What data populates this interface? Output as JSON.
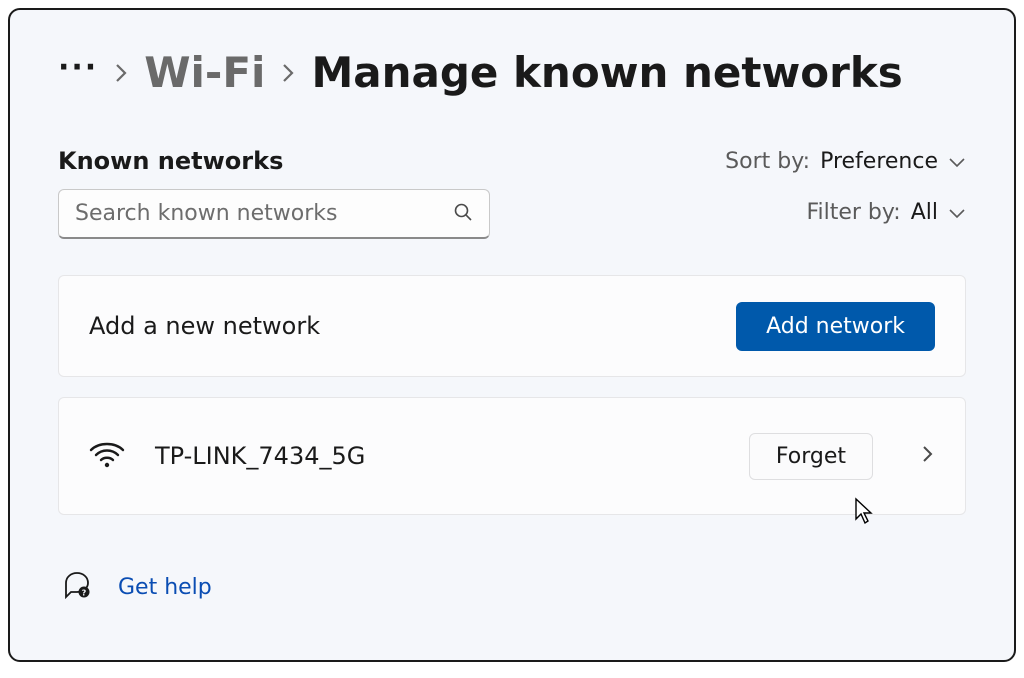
{
  "breadcrumb": {
    "wifi_label": "Wi-Fi",
    "current_label": "Manage known networks"
  },
  "section": {
    "header": "Known networks"
  },
  "search": {
    "placeholder": "Search known networks"
  },
  "sort": {
    "label": "Sort by:",
    "value": "Preference"
  },
  "filter": {
    "label": "Filter by:",
    "value": "All"
  },
  "add_card": {
    "label": "Add a new network",
    "button": "Add network"
  },
  "networks": [
    {
      "name": "TP-LINK_7434_5G",
      "forget_label": "Forget"
    }
  ],
  "help": {
    "label": "Get help"
  }
}
